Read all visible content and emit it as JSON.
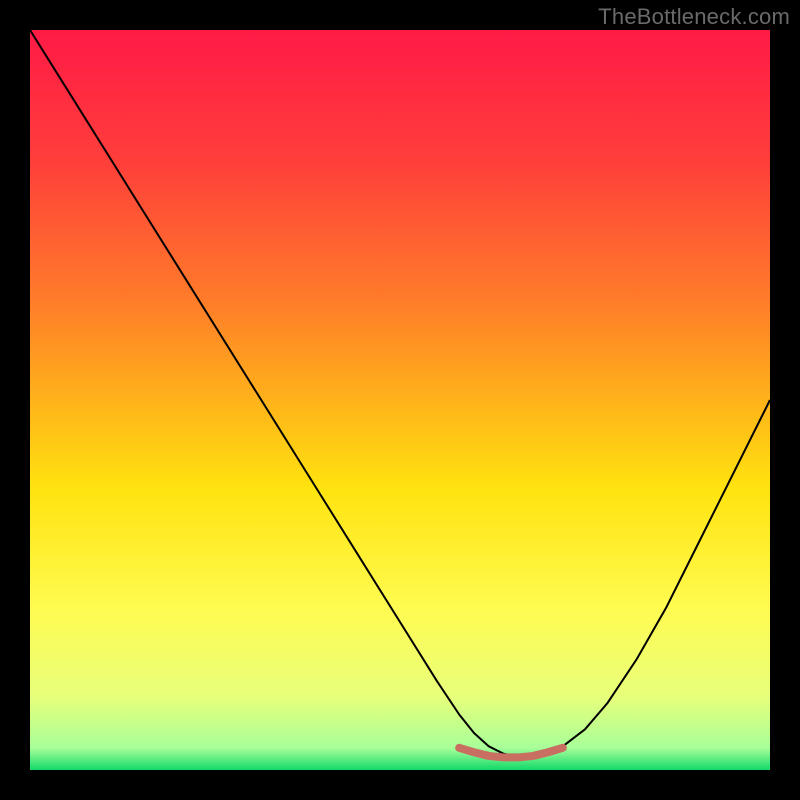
{
  "watermark": "TheBottleneck.com",
  "chart_data": {
    "type": "line",
    "title": "",
    "xlabel": "",
    "ylabel": "",
    "xlim": [
      0,
      100
    ],
    "ylim": [
      0,
      100
    ],
    "grid": false,
    "background_gradient": {
      "stops": [
        {
          "offset": 0.0,
          "color": "#ff1a46"
        },
        {
          "offset": 0.18,
          "color": "#ff3f3a"
        },
        {
          "offset": 0.36,
          "color": "#ff7a2a"
        },
        {
          "offset": 0.5,
          "color": "#ffb21a"
        },
        {
          "offset": 0.62,
          "color": "#ffe30f"
        },
        {
          "offset": 0.78,
          "color": "#fffb50"
        },
        {
          "offset": 0.9,
          "color": "#e8ff7a"
        },
        {
          "offset": 0.97,
          "color": "#a8ff99"
        },
        {
          "offset": 1.0,
          "color": "#12d96a"
        }
      ]
    },
    "series": [
      {
        "name": "bottleneck-curve",
        "color": "#000000",
        "stroke_width": 2,
        "x": [
          0.0,
          5,
          10,
          15,
          20,
          25,
          30,
          35,
          40,
          45,
          50,
          55,
          58,
          60,
          62,
          64,
          66,
          68,
          70,
          72,
          75,
          78,
          82,
          86,
          90,
          94,
          98,
          100
        ],
        "y": [
          100,
          92,
          84,
          76,
          68,
          60,
          52,
          44,
          36,
          28,
          20,
          12,
          7.5,
          5,
          3.2,
          2.2,
          1.8,
          1.8,
          2.2,
          3.2,
          5.5,
          9,
          15,
          22,
          30,
          38,
          46,
          50
        ]
      }
    ],
    "highlight": {
      "name": "optimal-band",
      "color": "#c96f62",
      "stroke_width": 8,
      "x": [
        58,
        60,
        62,
        64,
        66,
        68,
        70,
        72
      ],
      "y": [
        3.0,
        2.4,
        1.9,
        1.7,
        1.7,
        1.9,
        2.4,
        3.0
      ]
    }
  }
}
